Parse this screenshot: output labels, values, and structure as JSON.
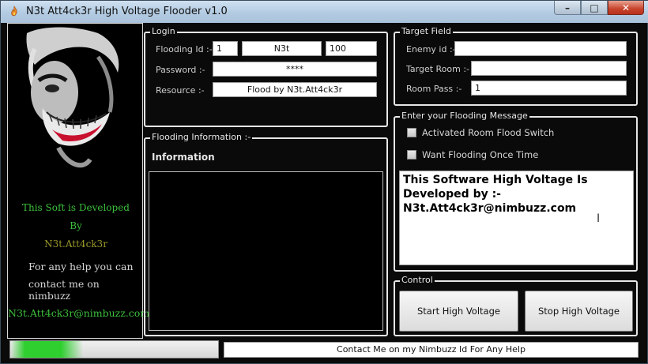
{
  "window": {
    "title": "N3t Att4ck3r High Voltage Flooder v1.0"
  },
  "left_panel": {
    "dev_line1": "This Soft is Developed",
    "dev_line2": "By",
    "dev_line3": "N3t.Att4ck3r",
    "help_line1": "For any help you can",
    "help_line2": "contact me on nimbuzz",
    "email": "N3t.Att4ck3r@nimbuzz.com"
  },
  "login": {
    "legend": "Login",
    "flooding_id_label": "Flooding Id :-",
    "flooding_id_1": "1",
    "flooding_id_2": "N3t",
    "flooding_id_3": "100",
    "password_label": "Password :-",
    "password_value": "****",
    "resource_label": "Resource :-",
    "resource_value": "Flood by N3t.Att4ck3r"
  },
  "target": {
    "legend": "Target Field",
    "enemy_label": "Enemy id :-",
    "enemy_value": "",
    "room_label": "Target Room :-",
    "room_value": "",
    "pass_label": "Room Pass :-",
    "pass_value": "1"
  },
  "info": {
    "legend": "Flooding Information :-",
    "title": "Information"
  },
  "message": {
    "legend": "Enter your Flooding Message",
    "check1_label": "Activated Room Flood Switch",
    "check2_label": "Want Flooding Once Time",
    "text": "This Software High Voltage Is\nDeveloped by :-\nN3t.Att4ck3r@nimbuzz.com"
  },
  "control": {
    "legend": "Control",
    "start_label": "Start High Voltage",
    "stop_label": "Stop High Voltage"
  },
  "status": {
    "progress_percent": 35,
    "text": "Contact Me on my Nimbuzz Id For Any Help"
  },
  "colors": {
    "accent_green": "#3dbf3d",
    "close_red": "#c7432c"
  }
}
